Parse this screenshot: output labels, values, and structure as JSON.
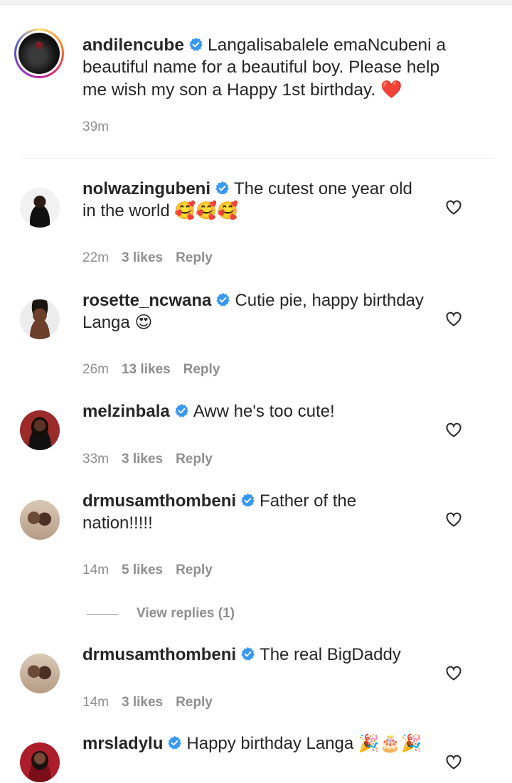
{
  "caption": {
    "username": "andilencube",
    "text": "Langalisabalele emaNcubeni a beautiful name for a beautiful boy. Please help me wish my son a Happy 1st birthday.",
    "emoji": "❤️",
    "time": "39m"
  },
  "comments": [
    {
      "username": "nolwazingubeni",
      "text": "The cutest one year old in the world",
      "emoji": "🥰🥰🥰",
      "time": "22m",
      "likes": "3 likes",
      "reply": "Reply"
    },
    {
      "username": "rosette_ncwana",
      "text": "Cutie pie, happy birthday Langa",
      "emoji": "😍",
      "time": "26m",
      "likes": "13 likes",
      "reply": "Reply"
    },
    {
      "username": "melzinbala",
      "text": "Aww he's too cute!",
      "emoji": "",
      "time": "33m",
      "likes": "3 likes",
      "reply": "Reply"
    },
    {
      "username": "drmusamthombeni",
      "text": "Father of the nation!!!!!",
      "emoji": "",
      "time": "14m",
      "likes": "5 likes",
      "reply": "Reply"
    },
    {
      "username": "drmusamthombeni",
      "text": "The real BigDaddy",
      "emoji": "",
      "time": "14m",
      "likes": "3 likes",
      "reply": "Reply"
    },
    {
      "username": "mrsladylu",
      "text": "Happy birthday Langa",
      "emoji": "🎉🎂🎉",
      "time": "",
      "likes": "",
      "reply": ""
    }
  ],
  "view_replies": "View replies (1)",
  "colors": {
    "verified": "#3897f0",
    "muted": "#8e8e8e",
    "text": "#262626",
    "heart_emoji": "#ed4956"
  },
  "icons": {
    "verified": "verified-badge-icon",
    "like": "heart-outline-icon"
  }
}
